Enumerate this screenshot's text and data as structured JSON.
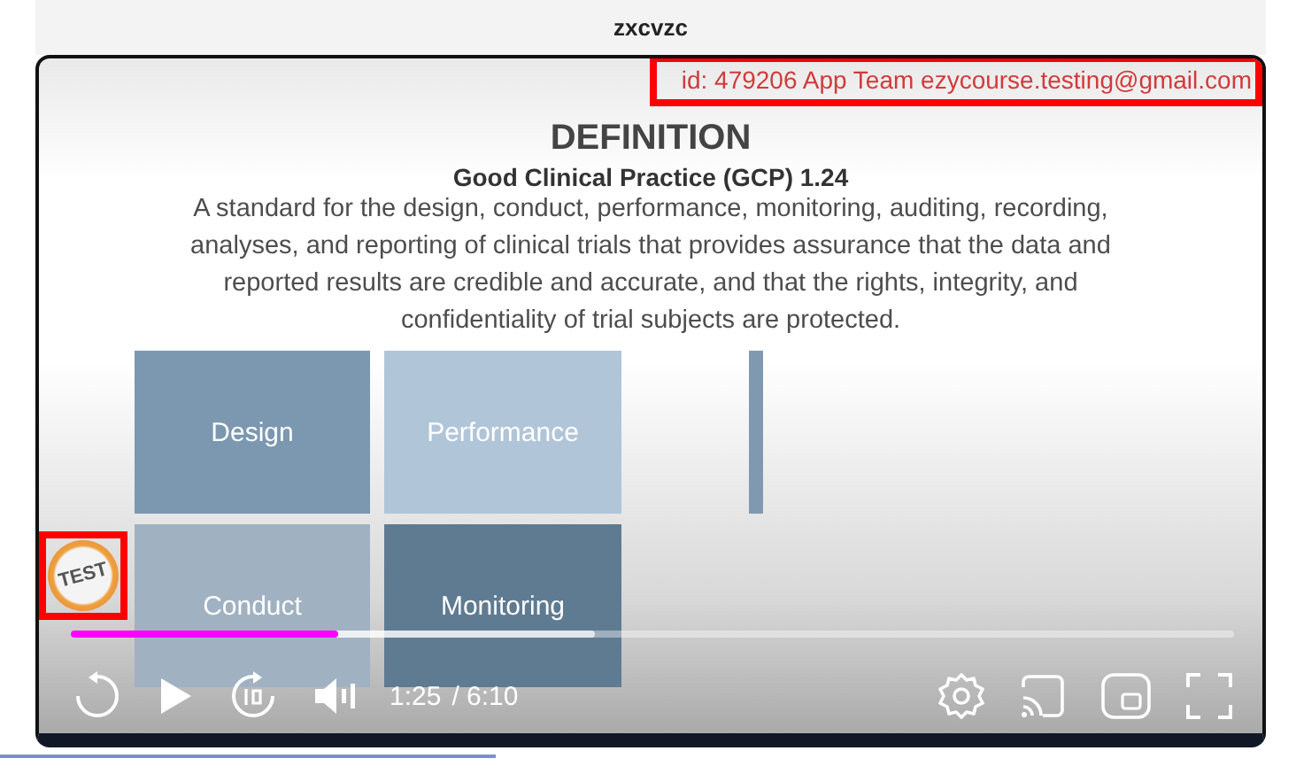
{
  "page_title": "zxcvzc",
  "watermark": {
    "text": "id: 479206 App Team ezycourse.testing@gmail.com",
    "highlighted": true
  },
  "slide": {
    "title": "DEFINITION",
    "subtitle": "Good Clinical Practice (GCP) 1.24",
    "body": "A standard for the design, conduct, performance, monitoring, auditing, recording, analyses, and reporting of clinical trials that provides assurance that the data and reported results are credible and accurate, and that the rights, integrity, and confidentiality of trial subjects are protected.",
    "tiles": [
      {
        "label": "Design",
        "color": "#7b98b0"
      },
      {
        "label": "Performance",
        "color": "#b1c5d8"
      },
      {
        "label": "Conduct",
        "color": "#a0b1c2"
      },
      {
        "label": "Monitoring",
        "color": "#5f7b92"
      }
    ]
  },
  "player": {
    "progress": {
      "level": 0.23
    },
    "buffer": {
      "level": 0.45
    },
    "time_current": "1:25",
    "time_total": "/ 6:10",
    "badge": {
      "text": "TEST",
      "highlighted": true
    }
  }
}
